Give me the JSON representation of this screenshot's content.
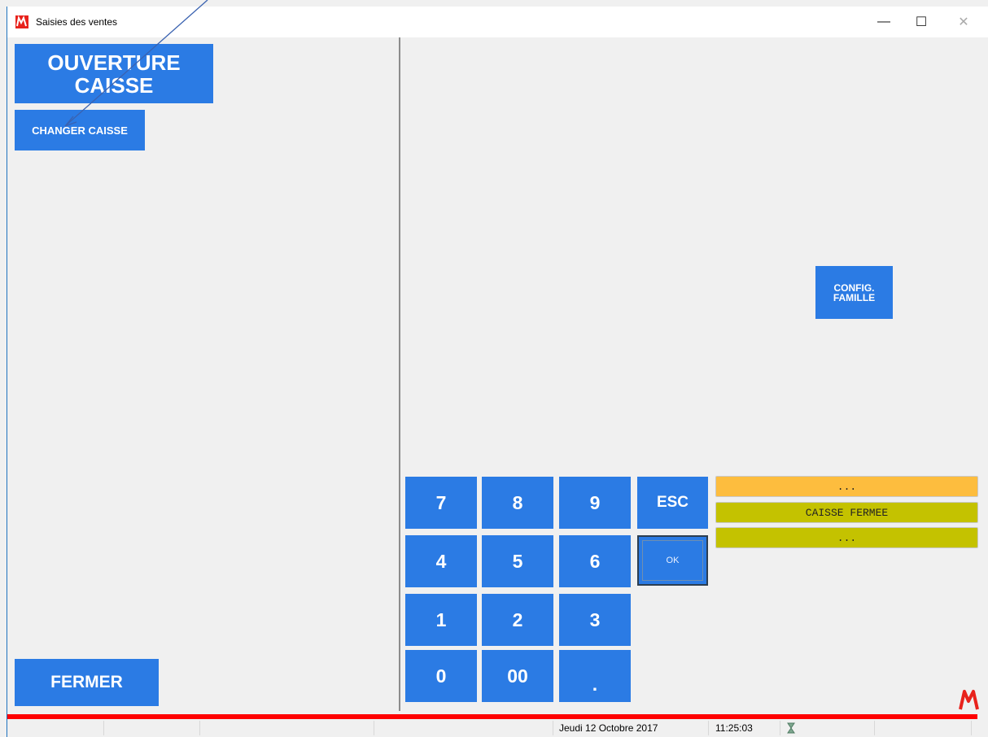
{
  "window": {
    "title": "Saisies des ventes",
    "controls": {
      "minimize": "—",
      "maximize": "☐",
      "close": "✕"
    }
  },
  "left_panel": {
    "ouverture_line1": "OUVERTURE",
    "ouverture_line2": "CAISSE",
    "changer_caisse": "CHANGER CAISSE",
    "fermer": "FERMER"
  },
  "right_panel": {
    "config_line1": "CONFIG.",
    "config_line2": "FAMILLE"
  },
  "keypad": {
    "keys": [
      "7",
      "8",
      "9",
      "4",
      "5",
      "6",
      "1",
      "2",
      "3",
      "0",
      "00",
      "."
    ],
    "esc": "ESC",
    "ok": "OK"
  },
  "status": {
    "line1": "...",
    "line2": "CAISSE FERMEE",
    "line3": "..."
  },
  "footer": {
    "date": "Jeudi 12 Octobre 2017",
    "time": "11:25:03"
  },
  "colors": {
    "button_blue": "#2b7be4",
    "status_orange": "#fdbd3e",
    "status_olive": "#c4c200",
    "accent_red": "#ff0000"
  },
  "icons": {
    "app": "app-logo-icon",
    "footer": "hourglass-icon"
  }
}
